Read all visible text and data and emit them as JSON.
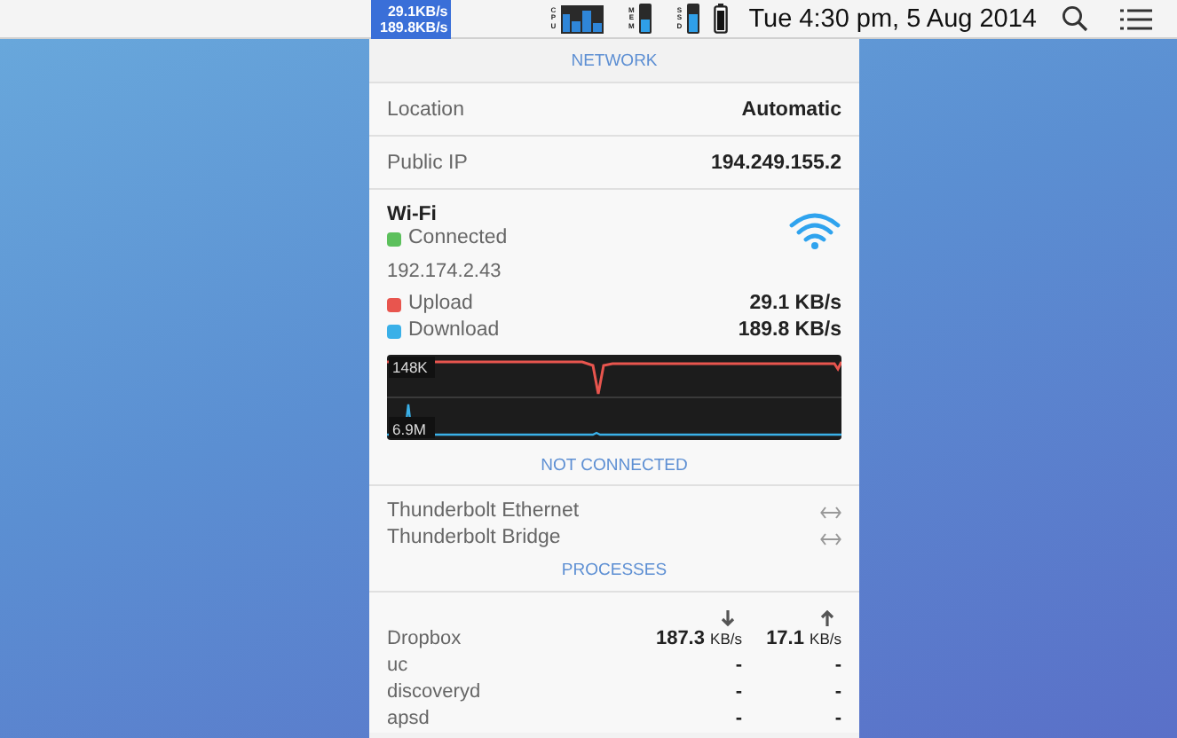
{
  "menubar": {
    "network_widget": {
      "upload": "29.1KB/s",
      "download": "189.8KB/s"
    },
    "meters": [
      {
        "label": "CPU",
        "kind": "bars"
      },
      {
        "label": "MEM",
        "kind": "bar",
        "level": 0.5
      },
      {
        "label": "SSD",
        "kind": "bar",
        "level": 0.65
      }
    ],
    "clock": "Tue 4:30 pm, 5 Aug 2014"
  },
  "network": {
    "title": "NETWORK",
    "rows": [
      {
        "label": "Location",
        "value": "Automatic"
      },
      {
        "label": "Public IP",
        "value": "194.249.155.2"
      }
    ],
    "wifi": {
      "name": "Wi-Fi",
      "status": "Connected",
      "connected": true,
      "ip": "192.174.2.43",
      "traffic": [
        {
          "label": "Upload",
          "value": "29.1 KB/s",
          "color": "#e8554e"
        },
        {
          "label": "Download",
          "value": "189.8 KB/s",
          "color": "#3ab0e8"
        }
      ],
      "graph": {
        "upload_label": "148K",
        "download_label": "6.9M"
      }
    }
  },
  "not_connected": {
    "title": "NOT CONNECTED",
    "interfaces": [
      {
        "name": "Thunderbolt Ethernet"
      },
      {
        "name": "Thunderbolt Bridge"
      }
    ]
  },
  "processes": {
    "title": "PROCESSES",
    "rows": [
      {
        "name": "Dropbox",
        "down": "187.3",
        "down_unit": "KB/s",
        "up": "17.1",
        "up_unit": "KB/s"
      },
      {
        "name": "uc",
        "down": "-",
        "up": "-"
      },
      {
        "name": "discoveryd",
        "down": "-",
        "up": "-"
      },
      {
        "name": "apsd",
        "down": "-",
        "up": "-"
      }
    ]
  }
}
